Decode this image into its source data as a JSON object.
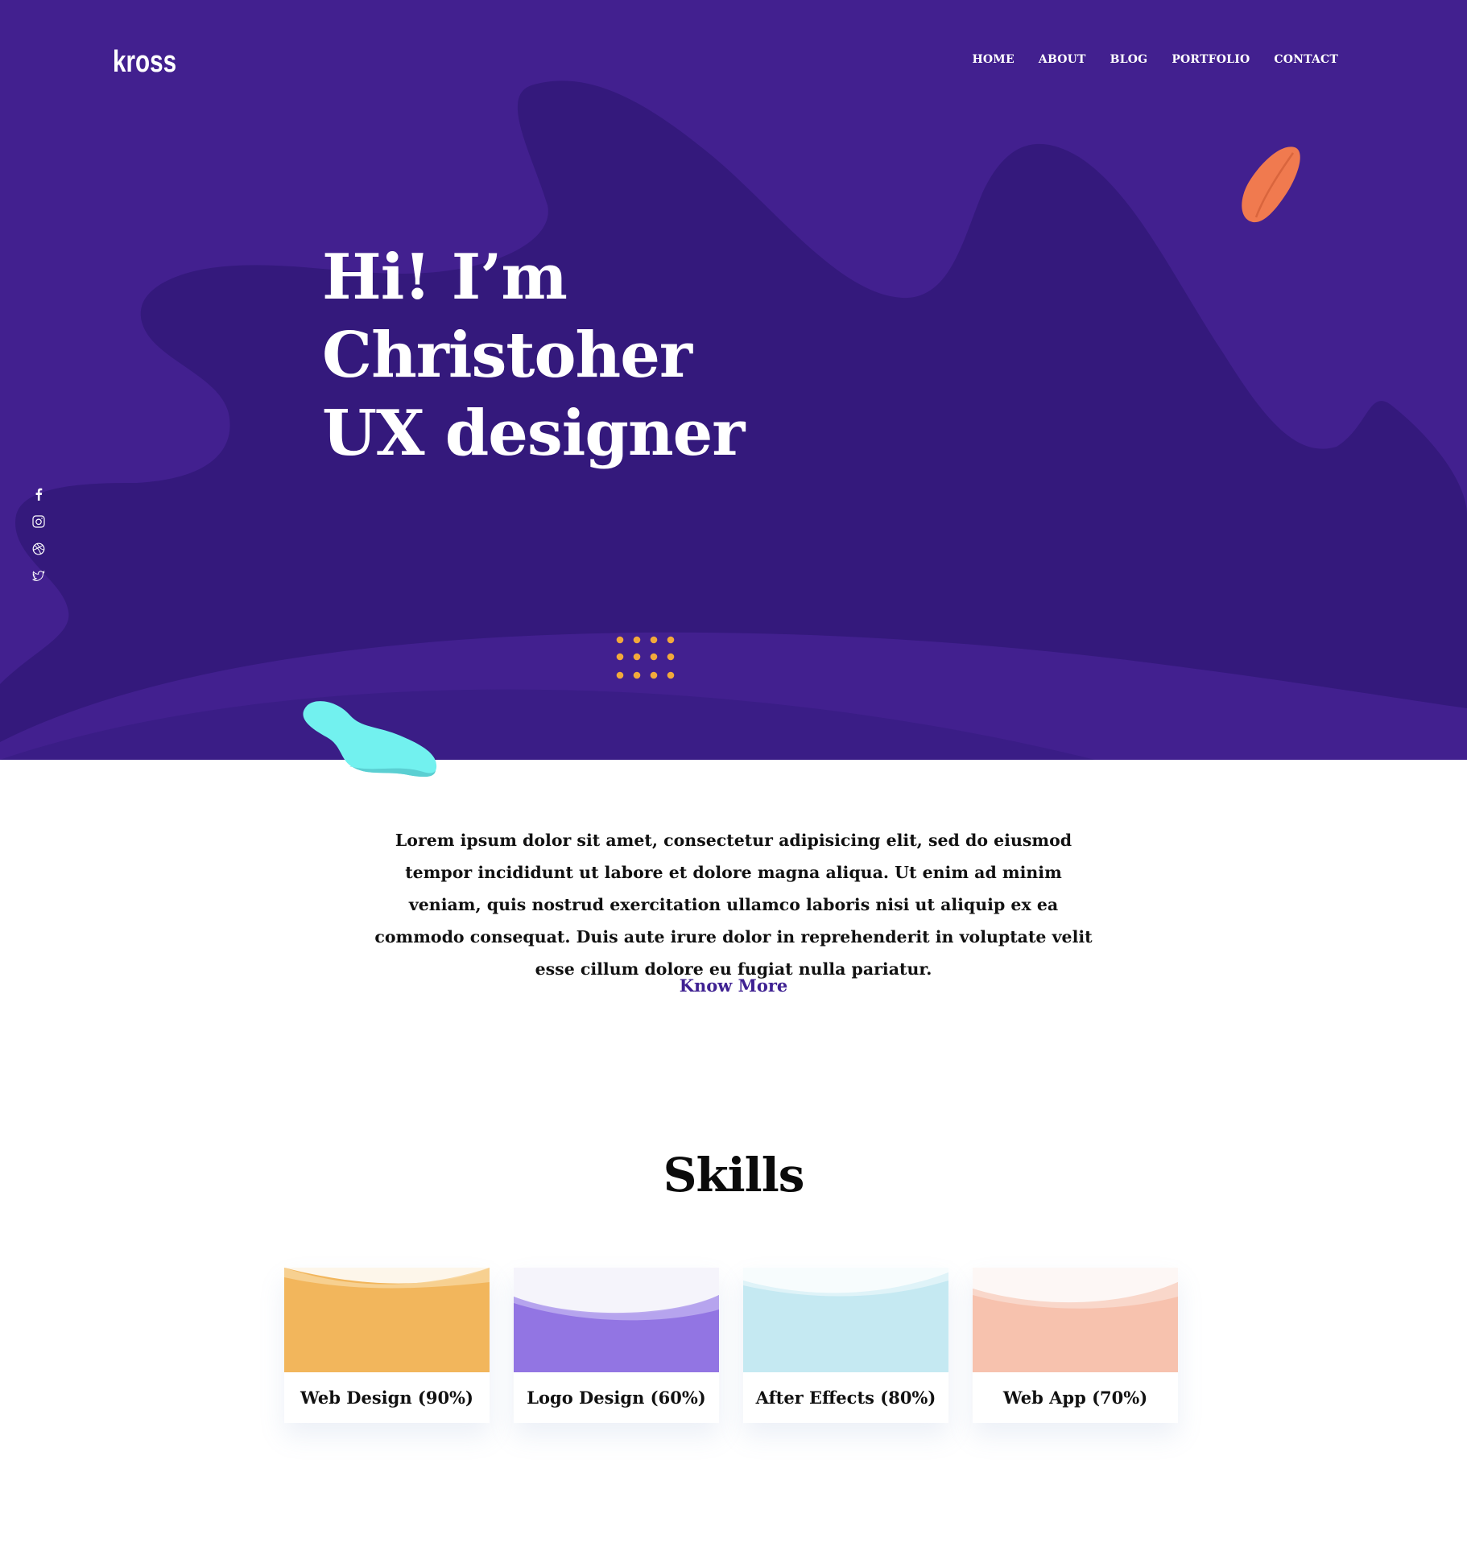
{
  "site": {
    "logo": "kross"
  },
  "nav": {
    "items": [
      {
        "label": "HOME"
      },
      {
        "label": "ABOUT"
      },
      {
        "label": "BLOG"
      },
      {
        "label": "PORTFOLIO"
      },
      {
        "label": "CONTACT"
      }
    ]
  },
  "hero": {
    "title_lines": [
      "Hi! I’m",
      "Christoher",
      "UX designer"
    ]
  },
  "social": {
    "icons": [
      "facebook-icon",
      "instagram-icon",
      "dribbble-icon",
      "twitter-icon"
    ]
  },
  "intro": {
    "text": "Lorem ipsum dolor sit amet, consectetur adipisicing elit, sed do eiusmod tempor incididunt ut labore et dolore magna aliqua. Ut enim ad minim veniam, quis nostrud exercitation ullamco laboris nisi ut aliquip ex ea commodo consequat. Duis aute irure dolor in reprehenderit in voluptate velit esse cillum dolore eu fugiat nulla pariatur.",
    "link_label": "Know More"
  },
  "skills": {
    "title": "Skills",
    "items": [
      {
        "label": "Web Design (90%)",
        "percent": 90,
        "color": "#f2b65c"
      },
      {
        "label": "Logo Design (60%)",
        "percent": 60,
        "color": "#9275e3"
      },
      {
        "label": "After Effects (80%)",
        "percent": 80,
        "color": "#c5e9f2"
      },
      {
        "label": "Web App (70%)",
        "percent": 70,
        "color": "#f7c2ae"
      }
    ]
  },
  "colors": {
    "hero_bg": "#42208f",
    "hero_shape": "#34197c",
    "accent_link": "#3f2192",
    "dots": "#f2a93b",
    "feather": "#f07a4f",
    "blob": "#72f1ef"
  }
}
